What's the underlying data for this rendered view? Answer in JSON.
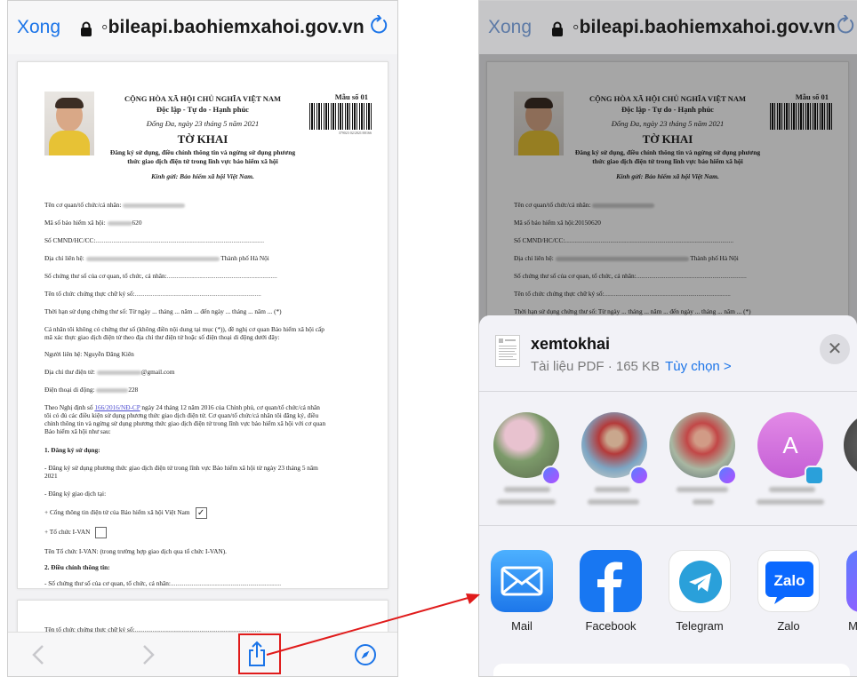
{
  "browser": {
    "done_label": "Xong",
    "url": "◦bileapi.baohiemxahoi.gov.vn"
  },
  "doc": {
    "republic": "CỘNG HÒA XÃ HỘI CHỦ NGHĨA VIỆT NAM",
    "motto": "Độc lập - Tự do - Hạnh phúc",
    "date": "Đống Đa, ngày 23 tháng 5 năm 2021",
    "form_no": "Mẫu số 01",
    "barcode_number": "379023 02/2021/00166",
    "title": "TỜ KHAI",
    "subtitle1": "Đăng ký sử dụng, điều chỉnh thông tin và ngừng sử dụng phương",
    "subtitle2": "thức giao dịch điện tử trong lĩnh vực bảo hiểm xã hội",
    "recipient": "Kính gửi: Bảo hiểm xã hội Việt Nam.",
    "org_label": "Tên cơ quan/tổ chức/cá nhân:",
    "ins_label": "Mã số bảo hiểm xã hội:",
    "ins_value_left": "620",
    "ins_value_right": "20150620",
    "id_label": "Số CMND/HC/CC:",
    "addr_label": "Địa chỉ liên hệ:",
    "addr_value": "Thành phố Hà Nội",
    "cert_label": "Số chứng thư số của cơ quan, tổ chức, cá nhân:",
    "ca_label": "Tên tổ chức chứng thực chữ ký số:",
    "period_label": "Thời hạn sử dụng chứng thư số: Từ ngày ... tháng ... năm ... đến ngày ... tháng ... năm ... (*)",
    "note1": "Cá nhân tôi không có chứng thư số (không điền nội dung tại mục (*)), đề nghị cơ quan Bảo hiểm xã hội cấp",
    "note2": "mã xác thực giao dịch điện tử theo địa chỉ thư điện tử hoặc số điện thoại di động dưới đây:",
    "contact_label": "Người liên hệ: Nguyễn Đăng Kiên",
    "email_label": "Địa chỉ thư điện tử:",
    "email_value": "@gmail.com",
    "phone_label": "Điện thoại di động:",
    "phone_value": "228",
    "decree_pre": "Theo Nghị định số",
    "decree_link": "166/2016/NĐ-CP",
    "decree_post": "ngày 24 tháng 12 năm 2016 của Chính phủ, cơ quan/tổ chức/cá nhân",
    "decree2": "tôi có đủ các điều kiện sử dụng phương thức giao dịch điện tử. Cơ quan/tổ chức/cá nhân tôi đăng ký, điều",
    "decree3": "chỉnh thông tin và ngừng sử dụng phương thức giao dịch điện tử trong lĩnh vực bảo hiểm xã hội với cơ quan",
    "decree4": "Bảo hiểm xã hội như sau:",
    "sec1": "1. Đăng ký sử dụng:",
    "sec1_text1": "- Đăng ký sử dụng phương thức giao dịch điện tử trong lĩnh vực Bảo hiểm xã hội từ ngày 23 tháng 5 năm",
    "sec1_text2": "2021",
    "reg_place": "- Đăng ký giao dịch tại:",
    "portal": "+ Cổng thông tin điện tử của Bảo hiểm xã hội Việt Nam",
    "ivan": "+ Tổ chức I-VAN",
    "ivan_name": "Tên Tổ chức I-VAN: (trong trường hợp giao dịch qua tổ chức I-VAN).",
    "sec2": "2. Điều chỉnh thông tin:",
    "sec2_text": "- Số chứng thư số của cơ quan, tổ chức, cá nhân:",
    "page2_ca": "Tên tổ chức chứng thực chữ ký số:"
  },
  "share": {
    "file_name": "xemtokhai",
    "file_meta": "Tài liệu PDF · 165 KB",
    "options": "Tùy chọn >",
    "avatar_letter": "A",
    "apps": [
      {
        "name": "Mail",
        "color": "#2d8cf5"
      },
      {
        "name": "Facebook",
        "color": "#1877f2"
      },
      {
        "name": "Telegram",
        "color": "#2aa0da"
      },
      {
        "name": "Zalo",
        "color": "#0a68ff"
      },
      {
        "name": "M"
      }
    ]
  },
  "colors": {
    "accent": "#1b74e8",
    "highlight": "#e01b1b"
  }
}
